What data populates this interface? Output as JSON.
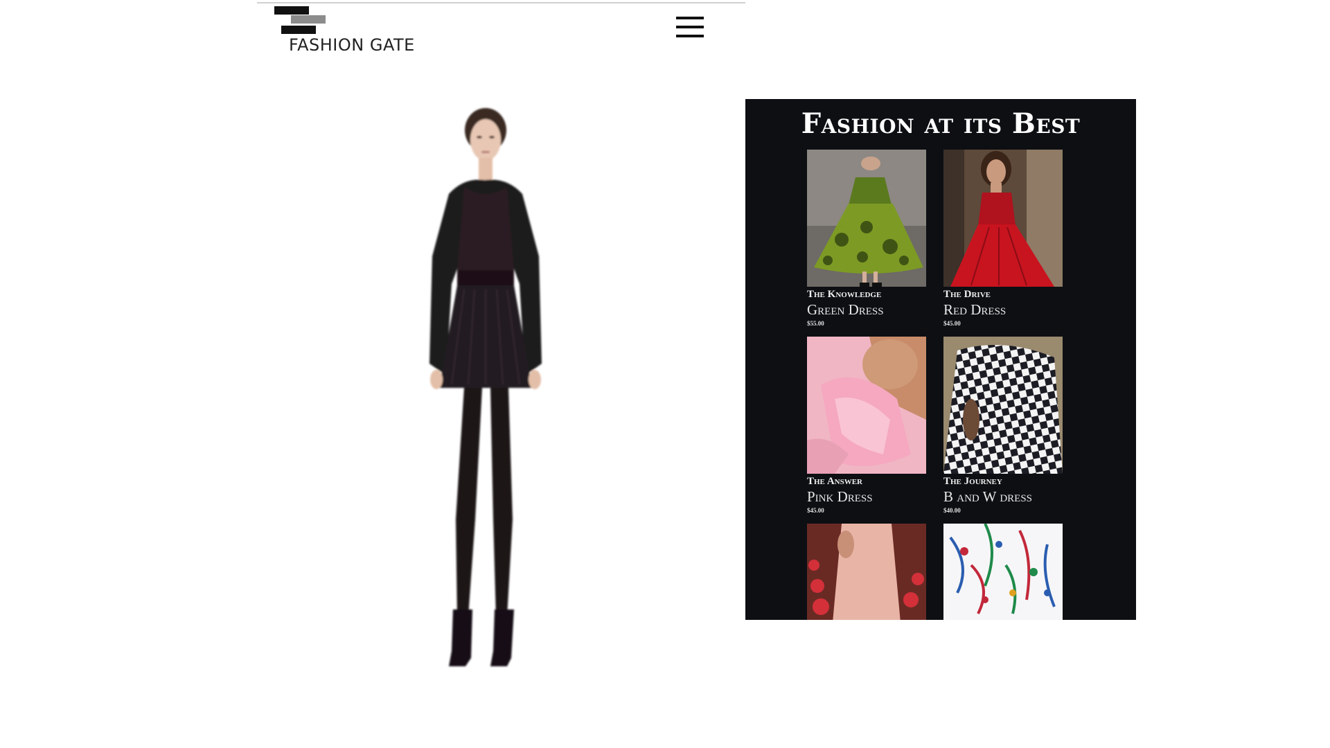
{
  "header": {
    "logo_text": "FASHION GATE",
    "menu_icon": "hamburger-icon"
  },
  "hero": {
    "image": "model-black-outfit"
  },
  "panel": {
    "title": "Fashion at its Best",
    "products": [
      {
        "subtitle": "The Knowledge",
        "name": "Green Dress",
        "price": "$55.00",
        "image": "green-dress"
      },
      {
        "subtitle": "The Drive",
        "name": "Red Dress",
        "price": "$45.00",
        "image": "red-dress"
      },
      {
        "subtitle": "The Answer",
        "name": "Pink Dress",
        "price": "$45.00",
        "image": "pink-dress"
      },
      {
        "subtitle": "The Journey",
        "name": "B and W dress",
        "price": "$40.00",
        "image": "black-white-gingham-dress"
      },
      {
        "image": "blush-dress"
      },
      {
        "image": "floral-dress"
      }
    ]
  },
  "colors": {
    "panel_background": "#0d0f13",
    "text_light": "#ffffff",
    "logo_dark": "#111111",
    "logo_gray": "#8c8c8c"
  }
}
